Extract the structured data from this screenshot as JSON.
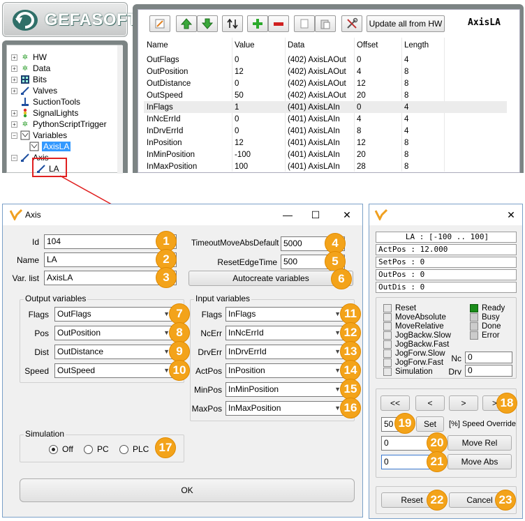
{
  "logo": {
    "text": "GEFASOFT"
  },
  "tree": {
    "items": [
      {
        "label": "HW"
      },
      {
        "label": "Data"
      },
      {
        "label": "Bits"
      },
      {
        "label": "Valves"
      },
      {
        "label": "SuctionTools"
      },
      {
        "label": "SignalLights"
      },
      {
        "label": "PythonScriptTrigger"
      },
      {
        "label": "Variables"
      },
      {
        "label": "AxisLA"
      },
      {
        "label": "Axis"
      },
      {
        "label": "LA"
      }
    ]
  },
  "toolbar": {
    "update_label": "Update all from HW",
    "title": "AxisLA"
  },
  "grid": {
    "headers": [
      "Name",
      "Value",
      "Data",
      "Offset",
      "Length"
    ],
    "rows": [
      [
        "OutFlags",
        "0",
        "(402) AxisLAOut",
        "0",
        "4"
      ],
      [
        "OutPosition",
        "12",
        "(402) AxisLAOut",
        "4",
        "8"
      ],
      [
        "OutDistance",
        "0",
        "(402) AxisLAOut",
        "12",
        "8"
      ],
      [
        "OutSpeed",
        "50",
        "(402) AxisLAOut",
        "20",
        "8"
      ],
      [
        "InFlags",
        "1",
        "(401) AxisLAIn",
        "0",
        "4"
      ],
      [
        "InNcErrId",
        "0",
        "(401) AxisLAIn",
        "4",
        "4"
      ],
      [
        "InDrvErrId",
        "0",
        "(401) AxisLAIn",
        "8",
        "4"
      ],
      [
        "InPosition",
        "12",
        "(401) AxisLAIn",
        "12",
        "8"
      ],
      [
        "InMinPosition",
        "-100",
        "(401) AxisLAIn",
        "20",
        "8"
      ],
      [
        "InMaxPosition",
        "100",
        "(401) AxisLAIn",
        "28",
        "8"
      ]
    ]
  },
  "axis_dialog": {
    "title": "Axis",
    "id_label": "Id",
    "id_value": "104",
    "name_label": "Name",
    "name_value": "LA",
    "varlist_label": "Var. list",
    "varlist_value": "AxisLA",
    "timeout_label": "TimeoutMoveAbsDefault",
    "timeout_value": "5000",
    "reset_label": "ResetEdgeTime",
    "reset_value": "500",
    "autocreate_label": "Autocreate variables",
    "output_group": "Output variables",
    "outputs": [
      {
        "label": "Flags",
        "value": "OutFlags"
      },
      {
        "label": "Pos",
        "value": "OutPosition"
      },
      {
        "label": "Dist",
        "value": "OutDistance"
      },
      {
        "label": "Speed",
        "value": "OutSpeed"
      }
    ],
    "input_group": "Input variables",
    "inputs": [
      {
        "label": "Flags",
        "value": "InFlags"
      },
      {
        "label": "NcErr",
        "value": "InNcErrId"
      },
      {
        "label": "DrvErr",
        "value": "InDrvErrId"
      },
      {
        "label": "ActPos",
        "value": "InPosition"
      },
      {
        "label": "MinPos",
        "value": "InMinPosition"
      },
      {
        "label": "MaxPos",
        "value": "InMaxPosition"
      }
    ],
    "simulation_group": "Simulation",
    "sim_options": [
      "Off",
      "PC",
      "PLC"
    ],
    "ok_label": "OK"
  },
  "badges": [
    "1",
    "2",
    "3",
    "4",
    "5",
    "6",
    "7",
    "8",
    "9",
    "10",
    "11",
    "12",
    "13",
    "14",
    "15",
    "16",
    "17",
    "18",
    "19",
    "20",
    "21",
    "22",
    "23"
  ],
  "control_dialog": {
    "status_lines": [
      "LA : [-100 .. 100]",
      "ActPos : 12.000",
      "SetPos : 0",
      "OutPos : 0",
      "OutDis : 0"
    ],
    "out_flags": [
      "Reset",
      "MoveAbsolute",
      "MoveRelative",
      "JogBackw.Slow",
      "JogBackw.Fast",
      "JogForw.Slow",
      "JogForw.Fast",
      "Simulation"
    ],
    "in_flags": [
      "Ready",
      "Busy",
      "Done",
      "Error"
    ],
    "nc_label": "Nc",
    "nc_value": "0",
    "drv_label": "Drv",
    "drv_value": "0",
    "jog": [
      "<<",
      "<",
      ">",
      ">>"
    ],
    "speed_value": "50",
    "set_label": "Set",
    "speed_override_label": "[%] Speed Override",
    "move_rel_value": "0",
    "move_rel_label": "Move Rel",
    "move_abs_value": "0",
    "move_abs_label": "Move Abs",
    "reset_label": "Reset",
    "cancel_label": "Cancel"
  },
  "colors": {
    "badge": "#f3a31a",
    "selection": "#3399ff",
    "ready": "#1a8c1a",
    "highlight": "#e02020"
  }
}
